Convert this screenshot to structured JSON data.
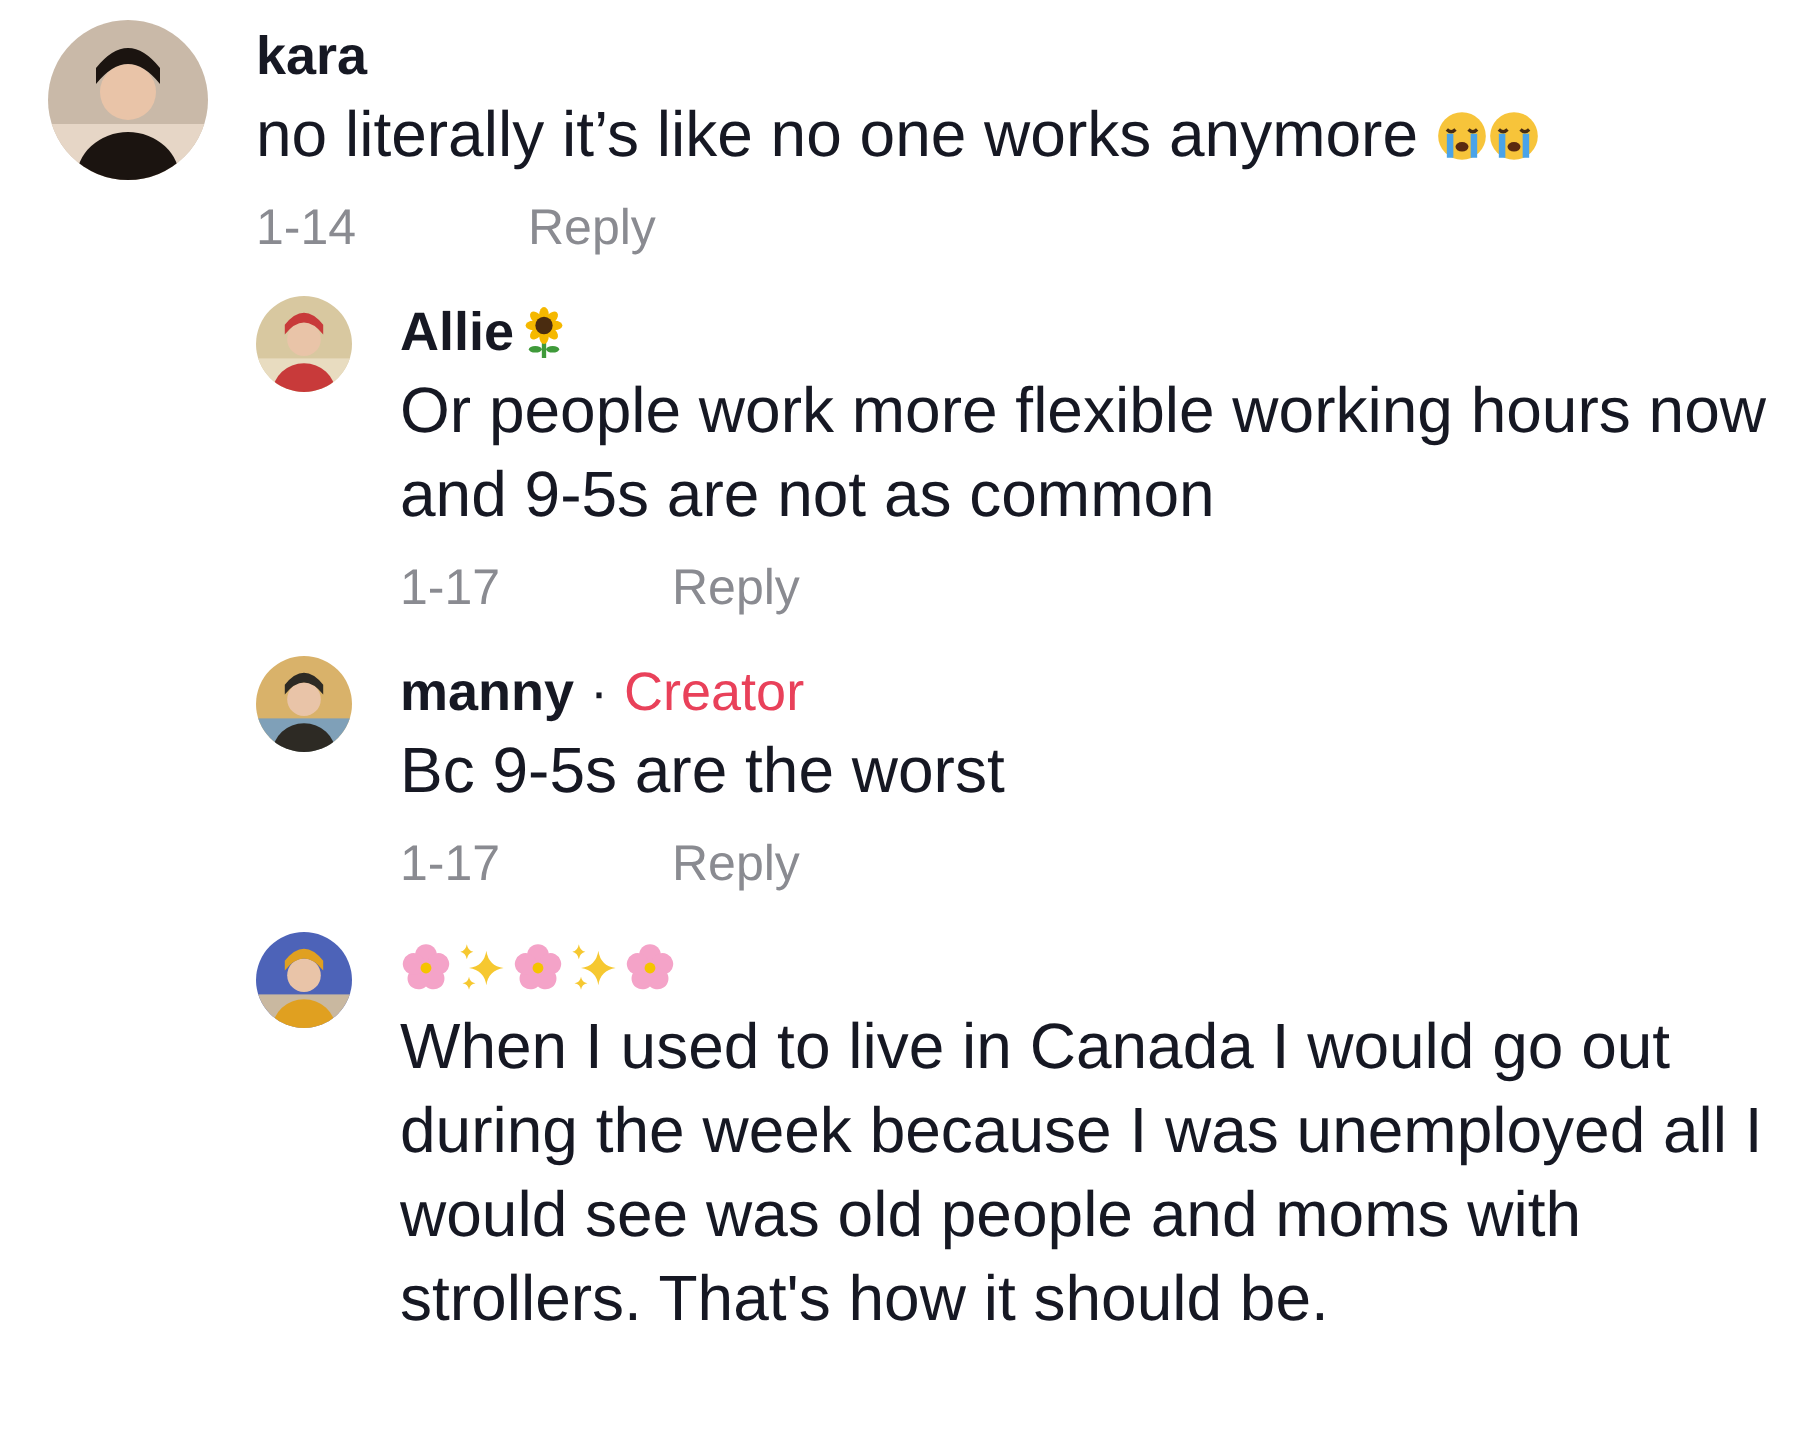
{
  "comments": [
    {
      "author": [
        {
          "kind": "text",
          "text": "kara"
        }
      ],
      "body": "no literally it’s like no one works anymore",
      "body_emoji": [
        {
          "kind": "crying"
        },
        {
          "kind": "crying"
        }
      ],
      "date": "1-14",
      "reply_label": "Reply",
      "replies": [
        {
          "author": [
            {
              "kind": "text",
              "text": "Allie"
            },
            {
              "kind": "sunflower"
            }
          ],
          "body": "Or people work more flexible working hours now and 9-5s are not as common",
          "date": "1-17",
          "reply_label": "Reply"
        },
        {
          "author": [
            {
              "kind": "text",
              "text": "manny"
            }
          ],
          "badge_separator": "·",
          "badge": "Creator",
          "body": "Bc 9-5s are the worst",
          "date": "1-17",
          "reply_label": "Reply"
        },
        {
          "author": [
            {
              "kind": "blossom"
            },
            {
              "kind": "sparkles"
            },
            {
              "kind": "blossom"
            },
            {
              "kind": "sparkles"
            },
            {
              "kind": "blossom"
            }
          ],
          "body": "When I used to live in Canada I would go out during the week because I was unemployed all I would see was old people and moms with strollers. That's how it should be."
        }
      ]
    }
  ]
}
